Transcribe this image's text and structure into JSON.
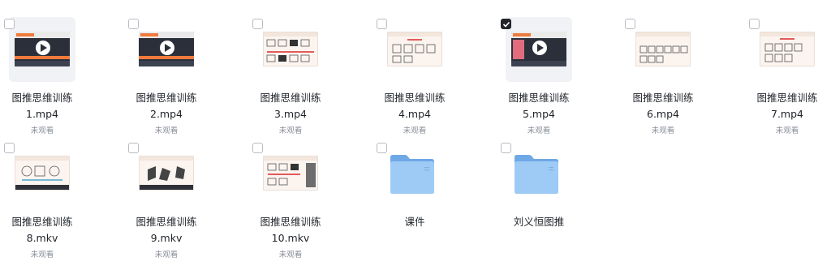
{
  "files": [
    {
      "line1": "图推思维训练",
      "line2": "1.mp4",
      "status": "未观看",
      "kind": "video",
      "variant": "dark",
      "checked": false
    },
    {
      "line1": "图推思维训练",
      "line2": "2.mp4",
      "status": "未观看",
      "kind": "video",
      "variant": "dark",
      "checked": false
    },
    {
      "line1": "图推思维训练",
      "line2": "3.mp4",
      "status": "未观看",
      "kind": "video",
      "variant": "light",
      "checked": false
    },
    {
      "line1": "图推思维训练",
      "line2": "4.mp4",
      "status": "未观看",
      "kind": "video",
      "variant": "light",
      "checked": false
    },
    {
      "line1": "图推思维训练",
      "line2": "5.mp4",
      "status": "未观看",
      "kind": "video",
      "variant": "dark",
      "checked": true
    },
    {
      "line1": "图推思维训练",
      "line2": "6.mp4",
      "status": "未观看",
      "kind": "video",
      "variant": "light",
      "checked": false
    },
    {
      "line1": "图推思维训练",
      "line2": "7.mp4",
      "status": "未观看",
      "kind": "video",
      "variant": "light",
      "checked": false
    },
    {
      "line1": "图推思维训练",
      "line2": "8.mkv",
      "status": "未观看",
      "kind": "video",
      "variant": "light",
      "checked": false
    },
    {
      "line1": "图推思维训练",
      "line2": "9.mkv",
      "status": "未观看",
      "kind": "video",
      "variant": "light",
      "checked": false
    },
    {
      "line1": "图推思维训练",
      "line2": "10.mkv",
      "status": "未观看",
      "kind": "video",
      "variant": "light",
      "checked": false
    },
    {
      "line1": "课件",
      "line2": "",
      "status": "",
      "kind": "folder",
      "variant": "",
      "checked": false
    },
    {
      "line1": "刘义恒图推",
      "line2": "",
      "status": "",
      "kind": "folder",
      "variant": "",
      "checked": false
    }
  ],
  "colors": {
    "folder_back": "#6fa8e6",
    "folder_front": "#9ecbf6",
    "checkbox_checked": "#22252b",
    "accent_orange": "#f07a3c"
  },
  "icons": {
    "play": "play-icon",
    "folder": "folder-icon",
    "checkbox": "checkbox-icon"
  }
}
